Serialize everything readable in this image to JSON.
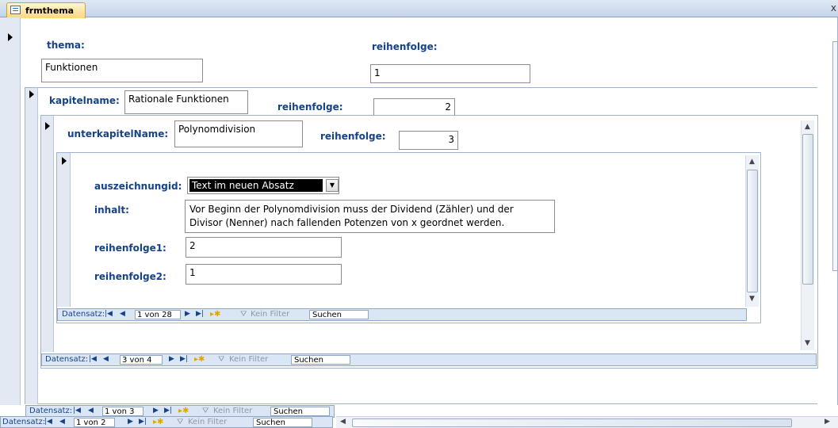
{
  "tab": {
    "label": "frmthema",
    "close": "x"
  },
  "main": {
    "thema_label": "thema:",
    "thema_value": "Funktionen",
    "reihenfolge_label": "reihenfolge:",
    "reihenfolge_value": "1"
  },
  "kapitel": {
    "name_label": "kapitelname:",
    "name_value": "Rationale Funktionen",
    "reihenfolge_label": "reihenfolge:",
    "reihenfolge_value": "2"
  },
  "unterkapitel": {
    "name_label": "unterkapitelName:",
    "name_value": "Polynomdivision",
    "reihenfolge_label": "reihenfolge:",
    "reihenfolge_value": "3"
  },
  "inhalt_form": {
    "auszeichnung_label": "auszeichnungid:",
    "auszeichnung_value": "Text im neuen Absatz",
    "inhalt_label": "inhalt:",
    "inhalt_line1": "Vor Beginn der Polynomdivision muss der Dividend (Zähler) und der",
    "inhalt_line2": "Divisor (Nenner) nach fallenden Potenzen von x geordnet werden.",
    "reihenfolge1_label": "reihenfolge1:",
    "reihenfolge1_value": "2",
    "reihenfolge2_label": "reihenfolge2:",
    "reihenfolge2_value": "1"
  },
  "nav": {
    "label": "Datensatz:",
    "filter": "Kein Filter",
    "search": "Suchen",
    "inner": "1 von 28",
    "unterkapitel": "3 von 4",
    "kapitel": "1 von 3",
    "thema": "1 von 2"
  },
  "icons": [
    "form-icon",
    "first-record-icon",
    "prev-record-icon",
    "next-record-icon",
    "last-record-icon",
    "new-record-icon",
    "filter-icon",
    "record-selector-arrow-icon"
  ],
  "colors": {
    "label_blue": "#15428b",
    "nav_bg": "#dbe6f5",
    "border": "#9fb4d0"
  }
}
